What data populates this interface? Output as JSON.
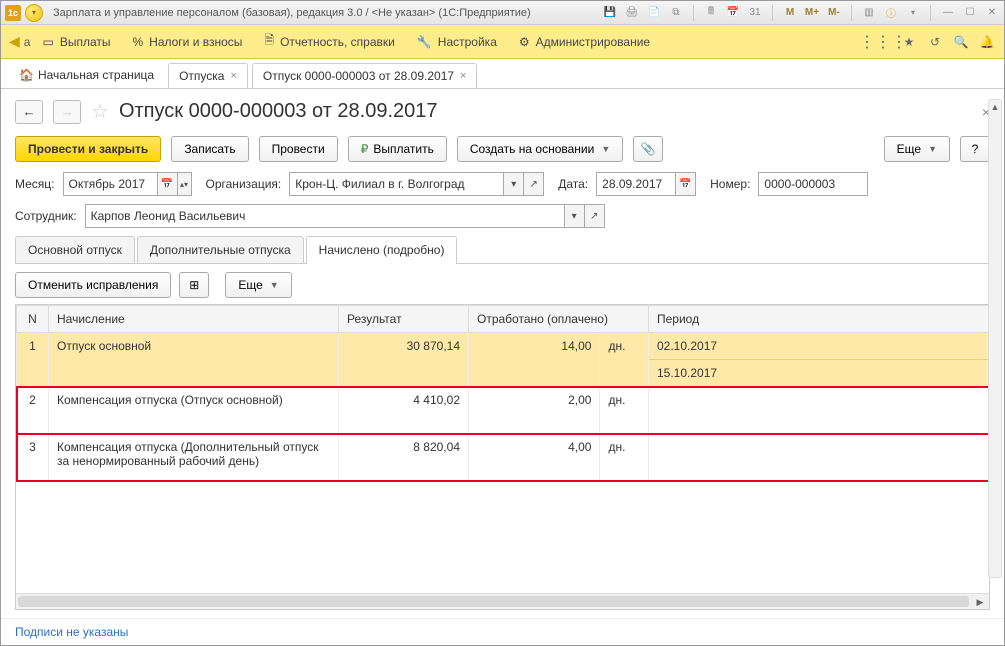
{
  "titlebar": {
    "app_title": "Зарплата и управление персоналом (базовая), редакция 3.0 / <Не указан>  (1С:Предприятие)",
    "m_labels": [
      "M",
      "M+",
      "M-"
    ]
  },
  "maintoolbar": {
    "left_letter": "а",
    "items": [
      {
        "label": "Выплаты"
      },
      {
        "label": "Налоги и взносы"
      },
      {
        "label": "Отчетность, справки"
      },
      {
        "label": "Настройка"
      },
      {
        "label": "Администрирование"
      }
    ]
  },
  "tabs": {
    "home": "Начальная страница",
    "items": [
      {
        "label": "Отпуска"
      },
      {
        "label": "Отпуск 0000-000003 от 28.09.2017"
      }
    ]
  },
  "document": {
    "title": "Отпуск 0000-000003 от 28.09.2017"
  },
  "commands": {
    "post_close": "Провести и закрыть",
    "save": "Записать",
    "post": "Провести",
    "pay": "Выплатить",
    "create_based": "Создать на основании",
    "more": "Еще",
    "help": "?"
  },
  "form": {
    "month_label": "Месяц:",
    "month_value": "Октябрь 2017",
    "org_label": "Организация:",
    "org_value": "Крон-Ц. Филиал в г. Волгоград",
    "date_label": "Дата:",
    "date_value": "28.09.2017",
    "number_label": "Номер:",
    "number_value": "0000-000003",
    "employee_label": "Сотрудник:",
    "employee_value": "Карпов Леонид Васильевич"
  },
  "inner_tabs": [
    "Основной отпуск",
    "Дополнительные отпуска",
    "Начислено (подробно)"
  ],
  "tab_toolbar": {
    "cancel_corrections": "Отменить исправления",
    "more": "Еще"
  },
  "table": {
    "headers": {
      "n": "N",
      "accrual": "Начисление",
      "result": "Результат",
      "worked": "Отработано (оплачено)",
      "unit": "",
      "period": "Период"
    },
    "rows": [
      {
        "n": "1",
        "accrual": "Отпуск основной",
        "result": "30 870,14",
        "worked": "14,00",
        "unit": "дн.",
        "period_from": "02.10.2017",
        "period_to": "15.10.2017",
        "selected": true
      },
      {
        "n": "2",
        "accrual": "Компенсация отпуска (Отпуск основной)",
        "result": "4 410,02",
        "worked": "2,00",
        "unit": "дн.",
        "period_from": "",
        "period_to": ""
      },
      {
        "n": "3",
        "accrual": "Компенсация отпуска (Дополнительный отпуск за ненормированный рабочий день)",
        "result": "8 820,04",
        "worked": "4,00",
        "unit": "дн.",
        "period_from": "",
        "period_to": ""
      }
    ]
  },
  "footer": {
    "signatures": "Подписи не указаны"
  }
}
